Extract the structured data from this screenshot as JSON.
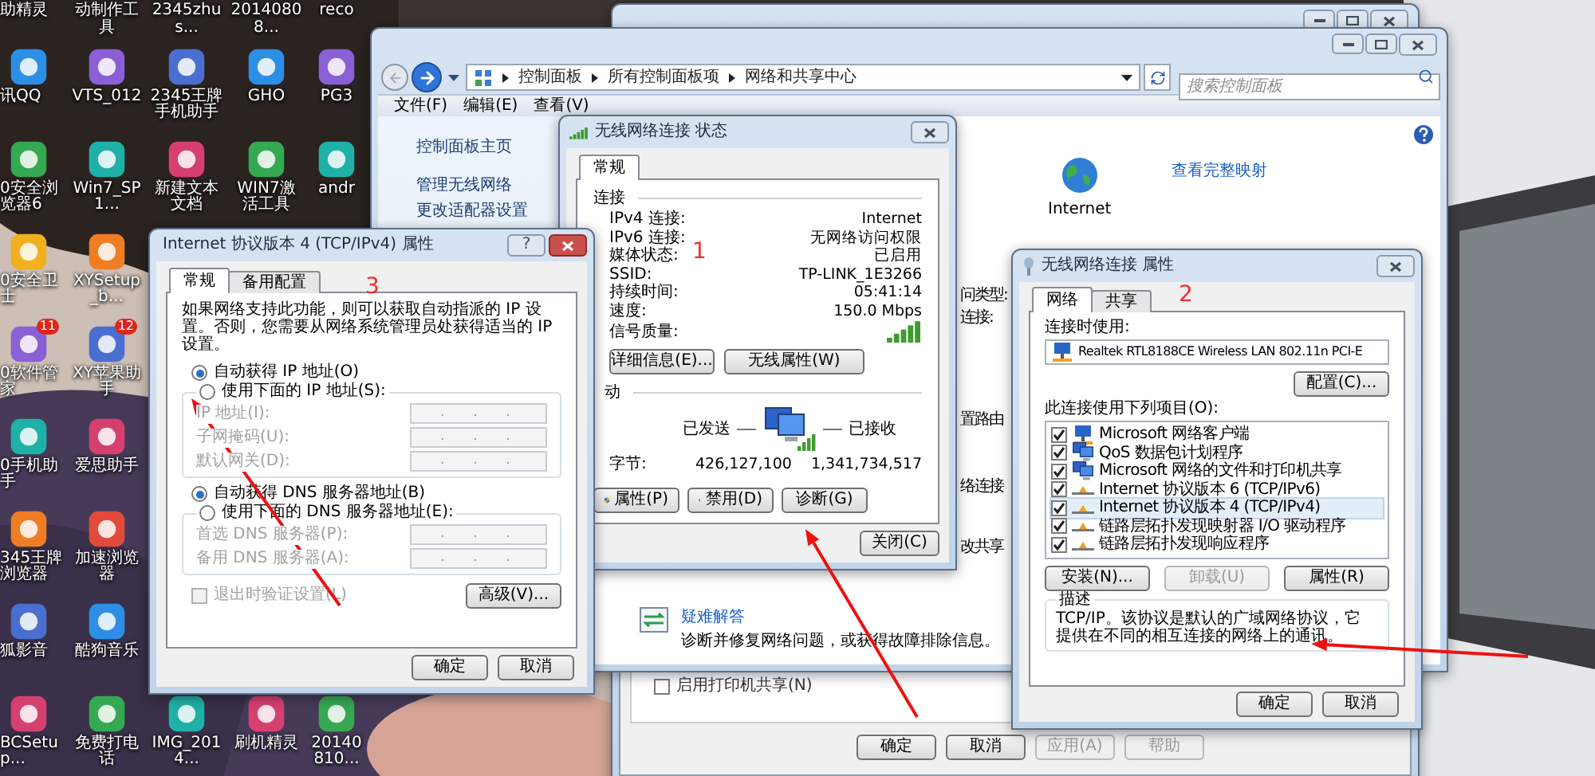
{
  "desktop": {
    "columns": [
      {
        "items": [
          {
            "label": "助精灵"
          },
          {
            "label": "讯QQ"
          },
          {
            "label": "0安全浏览器6"
          },
          {
            "label": "0安全卫士"
          },
          {
            "label": "0软件管家",
            "badge": "11"
          },
          {
            "label": "0手机助手"
          },
          {
            "label": "345王牌浏览器"
          },
          {
            "label": "狐影音"
          },
          {
            "label": "BCSetup..."
          }
        ]
      },
      {
        "items": [
          {
            "label": "动制作工具"
          },
          {
            "label": "VTS_012"
          },
          {
            "label": "Win7_SP1..."
          },
          {
            "label": "XYSetup_b..."
          },
          {
            "label": "XY苹果助手",
            "badge": "12"
          },
          {
            "label": "爱思助手"
          },
          {
            "label": "加速浏览器"
          },
          {
            "label": "酷狗音乐"
          },
          {
            "label": "免费打电话"
          }
        ]
      },
      {
        "items": [
          {
            "label": "2345zhus..."
          },
          {
            "label": "2345王牌手机助手"
          },
          {
            "label": "新建文本文档"
          }
        ],
        "bottom": {
          "label": "IMG_2014..."
        }
      },
      {
        "items": [
          {
            "label": "20140808..."
          },
          {
            "label": "GHO"
          },
          {
            "label": "WIN7激活工具"
          }
        ],
        "bottom": {
          "label": "刷机精灵"
        }
      },
      {
        "items": [
          {
            "label": "reco"
          },
          {
            "label": "PG3"
          },
          {
            "label": "andr"
          }
        ],
        "bottom": {
          "label": "20140810..."
        }
      }
    ]
  },
  "back_window": {
    "printer_sharing": {
      "label": "启用打印机共享(N)",
      "checked": false
    },
    "buttons": [
      {
        "label": "确定",
        "disabled": false
      },
      {
        "label": "取消",
        "disabled": false
      },
      {
        "label": "应用(A)",
        "disabled": true
      },
      {
        "label": "帮助",
        "disabled": true
      }
    ]
  },
  "control_panel": {
    "breadcrumb": [
      "控制面板",
      "所有控制面板项",
      "网络和共享中心"
    ],
    "search": {
      "placeholder": "搜索控制面板"
    },
    "menu": [
      "文件(F)",
      "编辑(E)",
      "查看(V)"
    ],
    "sidebar": {
      "items": [
        "控制面板主页",
        "管理无线网络",
        "更改适配器设置"
      ]
    },
    "network_map": {
      "node": "Internet",
      "link": "查看完整映射"
    },
    "fragments": [
      "问类型:",
      "连接:",
      "置路由",
      "络连接",
      "改共享"
    ],
    "troubleshoot": {
      "link": "疑难解答",
      "description": "诊断并修复网络问题，或获得故障排除信息。"
    }
  },
  "status_dialog": {
    "title": "无线网络连接 状态",
    "tabs": [
      {
        "label": "常规",
        "selected": true
      }
    ],
    "connection": {
      "heading": "连接",
      "rows": [
        {
          "kind": "text",
          "label": "IPv4 连接:",
          "value": "Internet"
        },
        {
          "kind": "text",
          "label": "IPv6 连接:",
          "value": "无网络访问权限"
        },
        {
          "kind": "text",
          "label": "媒体状态:",
          "value": "已启用"
        },
        {
          "kind": "text",
          "label": "SSID:",
          "value": "TP-LINK_1E3266"
        },
        {
          "kind": "text",
          "label": "持续时间:",
          "value": "05:41:14"
        },
        {
          "kind": "text",
          "label": "速度:",
          "value": "150.0 Mbps"
        },
        {
          "kind": "signal",
          "label": "信号质量:"
        }
      ]
    },
    "buttons": [
      "详细信息(E)...",
      "无线属性(W)"
    ],
    "activity": {
      "heading": "动",
      "sent": "已发送",
      "received": "已接收",
      "bytes_label": "字节:",
      "bytes_sent": "426,127,100",
      "bytes_received": "1,341,734,517"
    },
    "actions": [
      {
        "label": "属性(P)",
        "shield": true
      },
      {
        "label": "禁用(D)",
        "shield": true
      },
      {
        "label": "诊断(G)",
        "shield": false
      }
    ],
    "close": "关闭(C)"
  },
  "props_dialog": {
    "title": "无线网络连接 属性",
    "tabs": [
      {
        "label": "网络",
        "selected": true
      },
      {
        "label": "共享",
        "selected": false
      }
    ],
    "connect_using": "连接时使用:",
    "adapter": "Realtek RTL8188CE Wireless LAN 802.11n PCI-E",
    "configure": "配置(C)...",
    "items_label": "此连接使用下列项目(O):",
    "items": [
      {
        "kind": "client",
        "label": "Microsoft 网络客户端",
        "checked": true,
        "selected": false
      },
      {
        "kind": "service",
        "label": "QoS 数据包计划程序",
        "checked": true,
        "selected": false
      },
      {
        "kind": "service",
        "label": "Microsoft 网络的文件和打印机共享",
        "checked": true,
        "selected": false
      },
      {
        "kind": "protocol",
        "label": "Internet 协议版本 6 (TCP/IPv6)",
        "checked": true,
        "selected": false
      },
      {
        "kind": "protocol",
        "label": "Internet 协议版本 4 (TCP/IPv4)",
        "checked": true,
        "selected": true
      },
      {
        "kind": "protocol",
        "label": "链路层拓扑发现映射器 I/O 驱动程序",
        "checked": true,
        "selected": false
      },
      {
        "kind": "protocol",
        "label": "链路层拓扑发现响应程序",
        "checked": true,
        "selected": false
      }
    ],
    "actions": [
      {
        "label": "安装(N)...",
        "disabled": false
      },
      {
        "label": "卸载(U)",
        "disabled": true
      },
      {
        "label": "属性(R)",
        "disabled": false
      }
    ],
    "description_heading": "描述",
    "description": "TCP/IP。该协议是默认的广域网络协议，它提供在不同的相互连接的网络上的通讯。",
    "buttons": [
      "确定",
      "取消"
    ]
  },
  "tcp_dialog": {
    "title": "Internet 协议版本 4 (TCP/IPv4) 属性",
    "help_button": "?",
    "tabs": [
      {
        "label": "常规",
        "selected": true
      },
      {
        "label": "备用配置",
        "selected": false
      }
    ],
    "intro": "如果网络支持此功能，则可以获取自动指派的 IP 设置。否则，您需要从网络系统管理员处获得适当的 IP 设置。",
    "ip_options": [
      {
        "label": "自动获得 IP 地址(O)",
        "selected": true
      },
      {
        "label": "使用下面的 IP 地址(S):",
        "selected": false
      }
    ],
    "ip_fields": [
      {
        "label": "IP 地址(I):",
        "value": ".  .  ."
      },
      {
        "label": "子网掩码(U):",
        "value": ".  .  ."
      },
      {
        "label": "默认网关(D):",
        "value": ".  .  ."
      }
    ],
    "dns_options": [
      {
        "label": "自动获得 DNS 服务器地址(B)",
        "selected": true
      },
      {
        "label": "使用下面的 DNS 服务器地址(E):",
        "selected": false
      }
    ],
    "dns_fields": [
      {
        "label": "首选 DNS 服务器(P):",
        "value": ".  .  ."
      },
      {
        "label": "备用 DNS 服务器(A):",
        "value": ".  .  ."
      }
    ],
    "validate": {
      "label": "退出时验证设置(L)",
      "checked": false
    },
    "advanced": "高级(V)...",
    "buttons": [
      "确定",
      "取消"
    ]
  },
  "annotations": [
    {
      "text": "1"
    },
    {
      "text": "2"
    },
    {
      "text": "3"
    }
  ]
}
